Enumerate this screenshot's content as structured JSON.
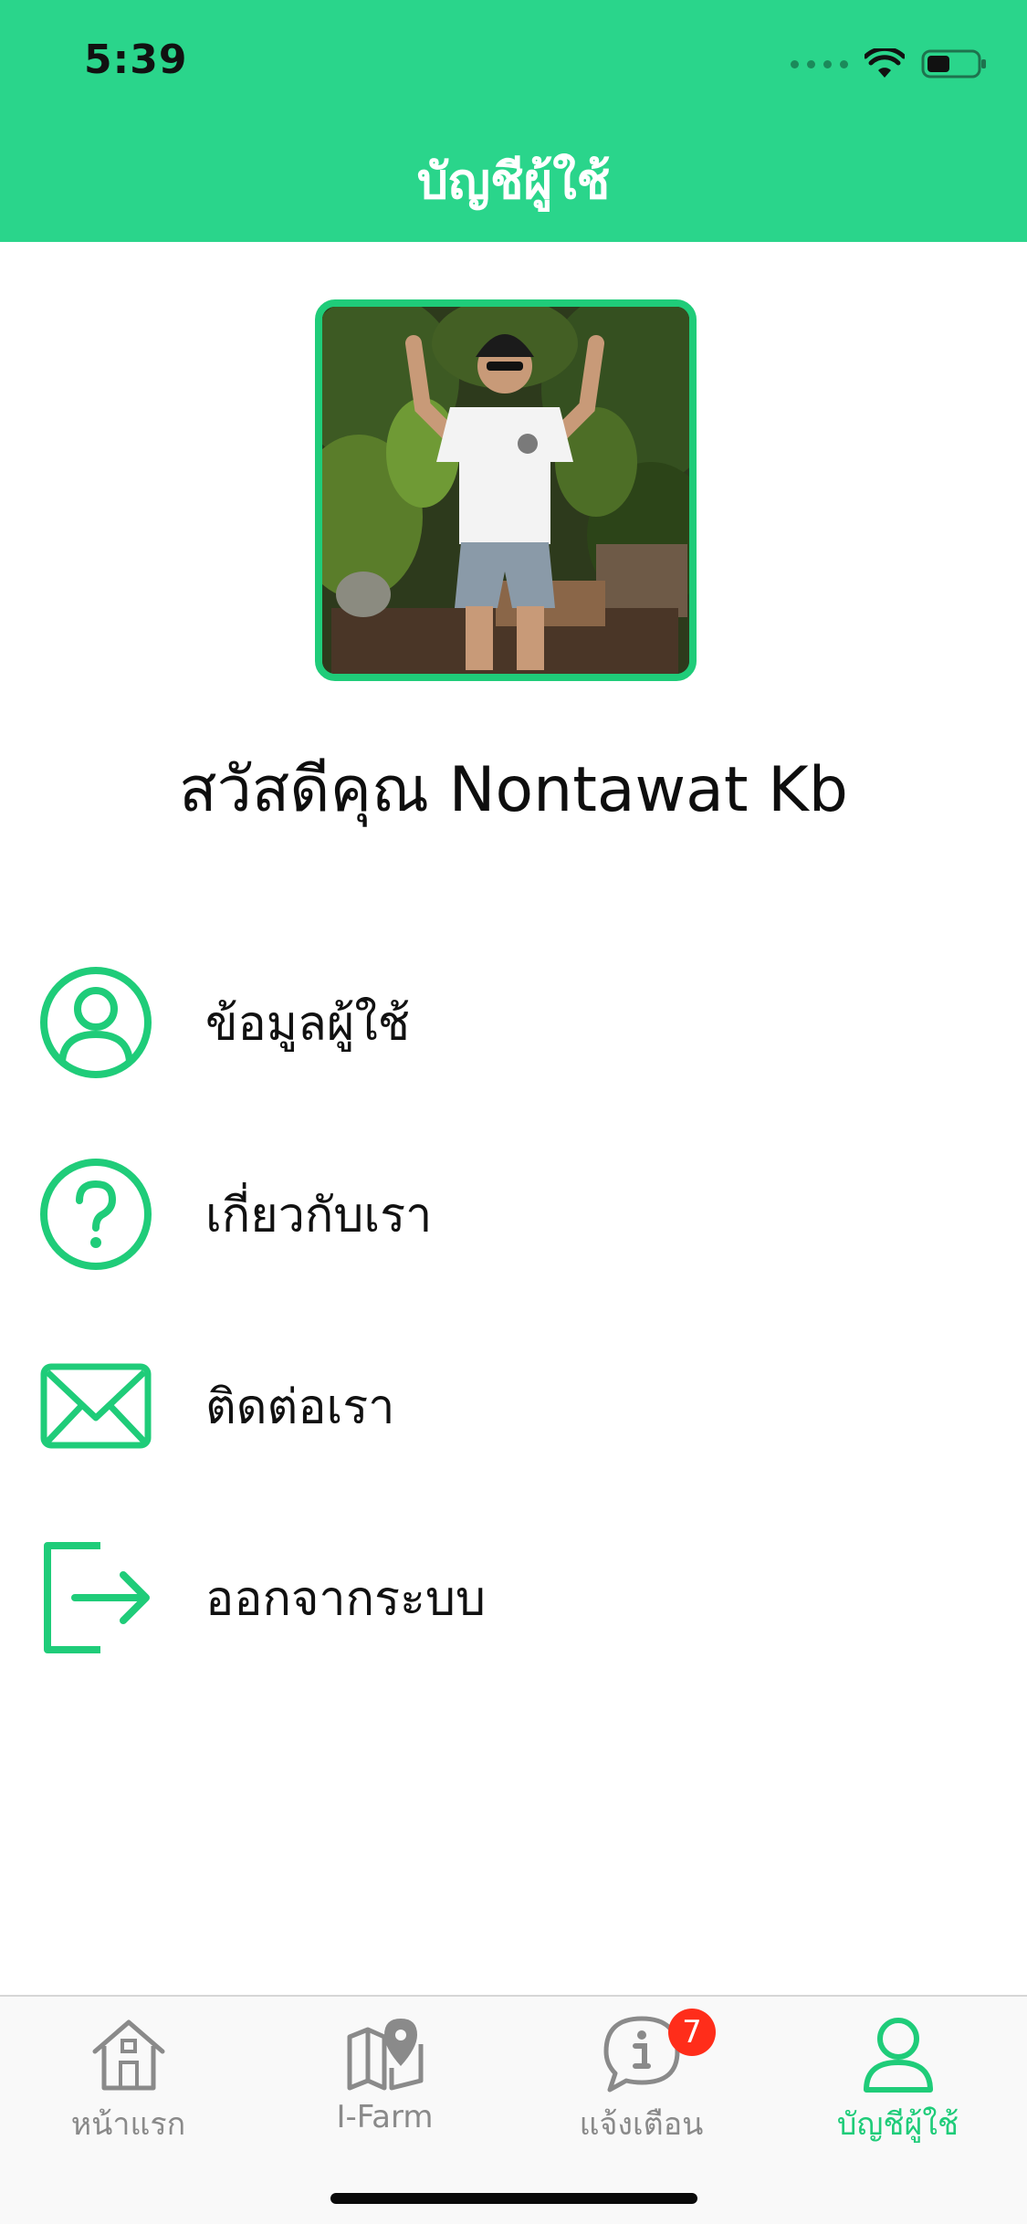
{
  "status_bar": {
    "time": "5:39"
  },
  "header": {
    "title": "บัญชีผู้ใช้"
  },
  "profile": {
    "greeting": "สวัสดีคุณ Nontawat Kb"
  },
  "menu": {
    "items": [
      {
        "label": "ข้อมูลผู้ใช้",
        "icon": "user-circle-icon"
      },
      {
        "label": "เกี่ยวกับเรา",
        "icon": "question-circle-icon"
      },
      {
        "label": "ติดต่อเรา",
        "icon": "envelope-icon"
      },
      {
        "label": "ออกจากระบบ",
        "icon": "logout-icon"
      }
    ]
  },
  "tabbar": {
    "tabs": [
      {
        "label": "หน้าแรก",
        "icon": "home-icon",
        "active": false
      },
      {
        "label": "I-Farm",
        "icon": "map-pin-icon",
        "active": false
      },
      {
        "label": "แจ้งเตือน",
        "icon": "info-bubble-icon",
        "active": false,
        "badge": "7"
      },
      {
        "label": "บัญชีผู้ใช้",
        "icon": "user-icon",
        "active": true
      }
    ]
  },
  "colors": {
    "accent": "#2ad58b",
    "accent_dark": "#1fcc79",
    "tab_inactive": "#8a8a8a",
    "badge": "#ff2d1a"
  }
}
